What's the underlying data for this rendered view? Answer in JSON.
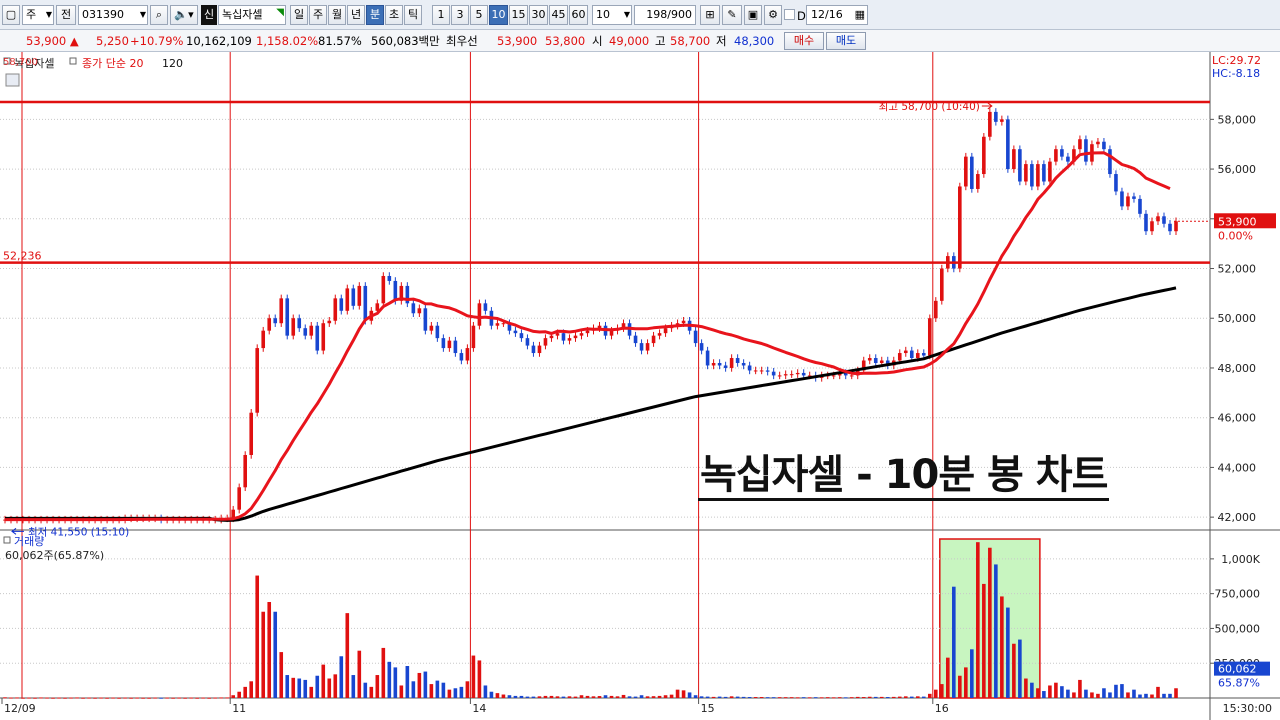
{
  "toolbar": {
    "type_label": "주",
    "all_label": "전",
    "code": "031390",
    "stock_badge": "신",
    "stock_name": "녹십자셀",
    "periods": [
      "일",
      "주",
      "월",
      "년",
      "분",
      "초",
      "틱"
    ],
    "active_period": "분",
    "intervals": [
      "1",
      "3",
      "5",
      "10",
      "15",
      "30",
      "45",
      "60"
    ],
    "active_interval": "10",
    "interval_value": "10",
    "count": "198",
    "count_total": "/900",
    "date_check": "D",
    "date": "12/16"
  },
  "quote": {
    "price": "53,900",
    "change": "5,250",
    "change_pct": "+10.79%",
    "volume": "10,162,109",
    "vol_ratio": "1,158.02%",
    "turnover": "81.57%",
    "amount": "560,083백만",
    "priority_label": "최우선",
    "ask": "53,900",
    "bid": "53,800",
    "open_label": "시",
    "open": "49,000",
    "high_label": "고",
    "high": "58,700",
    "low_label": "저",
    "low": "48,300",
    "buy_label": "매수",
    "sell_label": "매도"
  },
  "legend": {
    "series1": "녹십자셀",
    "ma_label": "종가 단순 20",
    "ma2": "120",
    "top_left_value": "58,700"
  },
  "annotations": {
    "high": "최고 58,700 (10:40)",
    "low": "최저 41,550 (15:10)",
    "hline_label": "52,236",
    "lc": "LC:29.72",
    "hc": "HC:-8.18",
    "current_price": "53,900",
    "current_pct": "0.00%",
    "overlay_title": "녹십자셀 - 10분 봉 차트",
    "volume_label": "거래량",
    "volume_value": "60,062주(65.87%)",
    "volume_current": "60,062",
    "volume_pct": "65.87%"
  },
  "colors": {
    "up": "#e01010",
    "down": "#1846d0",
    "ma20": "#e8141c",
    "ma120": "#000000",
    "highlight": "#c8f5c0"
  },
  "chart_data": {
    "type": "candlestick",
    "price_axis": {
      "min": 41000,
      "max": 59100,
      "ticks": [
        42000,
        44000,
        46000,
        48000,
        50000,
        52000,
        54000,
        56000,
        58000
      ]
    },
    "volume_axis": {
      "min": 0,
      "max": 1150000,
      "ticks": [
        250000,
        500000,
        750000,
        1000000
      ],
      "tick_labels": [
        "250,000",
        "500,000",
        "750,000",
        "1,000K"
      ]
    },
    "time_labels": [
      {
        "i": 0,
        "label": "12/09"
      },
      {
        "i": 38,
        "label": "11"
      },
      {
        "i": 78,
        "label": "14"
      },
      {
        "i": 116,
        "label": "15"
      },
      {
        "i": 155,
        "label": "16"
      }
    ],
    "time_end_label": "15:30:00",
    "hline": 52236,
    "high_line": 58700,
    "closes": [
      41900,
      41900,
      41900,
      41900,
      41900,
      41900,
      41900,
      41900,
      41900,
      41900,
      41900,
      41900,
      41900,
      41900,
      41900,
      41900,
      41900,
      41900,
      41900,
      41900,
      41950,
      41950,
      41950,
      41950,
      41950,
      41950,
      41900,
      41900,
      41900,
      41900,
      41900,
      41900,
      41900,
      41900,
      41900,
      41900,
      41950,
      41950,
      42300,
      43200,
      44500,
      46200,
      48800,
      49500,
      50000,
      49800,
      50800,
      49300,
      50000,
      49600,
      49300,
      49700,
      48700,
      49800,
      49900,
      50800,
      50300,
      51200,
      50500,
      51300,
      49900,
      50300,
      50600,
      51700,
      51500,
      50700,
      51300,
      50600,
      50200,
      50400,
      49500,
      49700,
      49200,
      48800,
      49100,
      48600,
      48300,
      48800,
      49700,
      50600,
      50300,
      49700,
      49800,
      49800,
      49500,
      49400,
      49200,
      48900,
      48600,
      48900,
      49200,
      49300,
      49400,
      49100,
      49200,
      49300,
      49400,
      49500,
      49600,
      49700,
      49300,
      49500,
      49600,
      49800,
      49300,
      49000,
      48700,
      49000,
      49300,
      49400,
      49600,
      49700,
      49800,
      49900,
      49500,
      49000,
      48700,
      48100,
      48200,
      48100,
      48000,
      48400,
      48200,
      48100,
      47900,
      47900,
      47900,
      47850,
      47700,
      47700,
      47750,
      47750,
      47800,
      47700,
      47700,
      47600,
      47700,
      47700,
      47700,
      47800,
      47700,
      47700,
      47900,
      48300,
      48400,
      48200,
      48300,
      48100,
      48300,
      48600,
      48700,
      48400,
      48600,
      48500,
      50000,
      50700,
      52000,
      52500,
      52000,
      55300,
      56500,
      55200,
      55800,
      57300,
      58300,
      57900,
      58000,
      56000,
      56800,
      55500,
      56200,
      55300,
      56200,
      55500,
      56300,
      56800,
      56500,
      56300,
      56800,
      57200,
      56300,
      57000,
      57100,
      56800,
      55800,
      55100,
      54500,
      54900,
      54800,
      54200,
      53500,
      53900,
      54100,
      53800,
      53500,
      53900
    ],
    "volumes": [
      5000,
      3000,
      4000,
      2000,
      3000,
      2000,
      4000,
      3000,
      2000,
      3000,
      2000,
      3000,
      4000,
      2000,
      3000,
      2000,
      3000,
      2000,
      3000,
      2000,
      3000,
      2000,
      3000,
      2000,
      2000,
      3000,
      2000,
      3000,
      2000,
      3000,
      2000,
      3000,
      2000,
      3000,
      2000,
      3000,
      4000,
      4000,
      20000,
      45000,
      80000,
      120000,
      880000,
      620000,
      690000,
      620000,
      330000,
      165000,
      145000,
      140000,
      130000,
      80000,
      160000,
      240000,
      140000,
      170000,
      300000,
      610000,
      165000,
      340000,
      110000,
      80000,
      165000,
      360000,
      260000,
      220000,
      90000,
      230000,
      120000,
      180000,
      190000,
      100000,
      125000,
      110000,
      60000,
      70000,
      80000,
      120000,
      305000,
      270000,
      90000,
      45000,
      35000,
      25000,
      20000,
      15000,
      15000,
      10000,
      10000,
      12000,
      15000,
      15000,
      12000,
      10000,
      12000,
      10000,
      20000,
      15000,
      12000,
      14000,
      20000,
      15000,
      12000,
      22000,
      12000,
      10000,
      20000,
      12000,
      13000,
      15000,
      20000,
      24000,
      60000,
      55000,
      40000,
      20000,
      12000,
      10000,
      8000,
      10000,
      8000,
      12000,
      10000,
      8000,
      7000,
      7000,
      7000,
      6000,
      6000,
      6000,
      6000,
      6000,
      5000,
      6000,
      5000,
      6000,
      5000,
      6000,
      5000,
      6000,
      5000,
      6000,
      8000,
      7000,
      9000,
      8000,
      8000,
      7000,
      8000,
      10000,
      12000,
      10000,
      12000,
      10000,
      30000,
      60000,
      100000,
      290000,
      800000,
      160000,
      220000,
      350000,
      1120000,
      820000,
      1080000,
      960000,
      730000,
      650000,
      390000,
      420000,
      140000,
      110000,
      70000,
      50000,
      90000,
      110000,
      85000,
      60000,
      40000,
      130000,
      60000,
      40000,
      30000,
      70000,
      40000,
      95000,
      100000,
      40000,
      60000,
      25000,
      30000,
      25000,
      80000,
      30000,
      30000,
      70000,
      55000,
      60062
    ],
    "ma20": [
      41900,
      41900,
      41900,
      41900,
      41900,
      41900,
      41900,
      41900,
      41900,
      41900,
      41900,
      41900,
      41900,
      41900,
      41900,
      41900,
      41900,
      41900,
      41900,
      41900,
      41903,
      41905,
      41908,
      41910,
      41913,
      41915,
      41915,
      41915,
      41915,
      41915,
      41915,
      41915,
      41915,
      41915,
      41915,
      41915,
      41918,
      41920,
      41938,
      42003,
      42133,
      42348,
      42693,
      43073,
      43478,
      43870,
      44310,
      44678,
      45083,
      45468,
      45833,
      46220,
      46560,
      46953,
      47350,
      47795,
      48213,
      48678,
      49108,
      49568,
      49935,
      50090,
      50195,
      50470,
      50600,
      50740,
      50785,
      50753,
      50770,
      50700,
      50580,
      50575,
      50500,
      50455,
      50415,
      50330,
      50220,
      50100,
      50060,
      50025,
      50045,
      50015,
      49990,
      49895,
      49795,
      49725,
      49620,
      49550,
      49470,
      49445,
      49455,
      49385,
      49475,
      49470,
      49445,
      49480,
      49535,
      49570,
      49560,
      49555,
      49545,
      49535,
      49555,
      49605,
      49595,
      49575,
      49575,
      49580,
      49615,
      49640,
      49660,
      49680,
      49700,
      49715,
      49715,
      49700,
      49665,
      49595,
      49525,
      49445,
      49380,
      49325,
      49255,
      49170,
      49100,
      49045,
      48985,
      48900,
      48805,
      48715,
      48625,
      48545,
      48460,
      48370,
      48290,
      48220,
      48170,
      48105,
      48040,
      47935,
      47855,
      47790,
      47775,
      47785,
      47795,
      47790,
      47800,
      47813,
      47838,
      47883,
      47930,
      47963,
      48003,
      48040,
      48155,
      48303,
      48520,
      48758,
      48973,
      49353,
      49793,
      50168,
      50573,
      51053,
      51558,
      52018,
      52503,
      52873,
      53303,
      53658,
      54055,
      54390,
      54790,
      55040,
      55325,
      55635,
      55873,
      56093,
      56338,
      56578,
      56620,
      56645,
      56650,
      56653,
      56528,
      56358,
      56185,
      56113,
      56023,
      55858,
      55638,
      55530,
      55420,
      55320,
      55213
    ],
    "ma120": [
      41950,
      41950,
      41950,
      41950,
      41950,
      41950,
      41950,
      41950,
      41950,
      41950,
      41950,
      41950,
      41950,
      41950,
      41950,
      41950,
      41950,
      41950,
      41950,
      41950,
      41950,
      41950,
      41950,
      41950,
      41950,
      41950,
      41950,
      41950,
      41950,
      41950,
      41950,
      41950,
      41950,
      41950,
      41950,
      41900,
      41880,
      41870,
      41875,
      41900,
      41960,
      42040,
      42140,
      42230,
      42310,
      42380,
      42450,
      42520,
      42590,
      42660,
      42730,
      42800,
      42870,
      42940,
      43010,
      43080,
      43150,
      43220,
      43290,
      43360,
      43430,
      43500,
      43570,
      43640,
      43710,
      43780,
      43850,
      43920,
      43990,
      44060,
      44130,
      44200,
      44270,
      44330,
      44390,
      44450,
      44510,
      44570,
      44630,
      44690,
      44750,
      44810,
      44870,
      44930,
      44990,
      45050,
      45110,
      45170,
      45230,
      45290,
      45350,
      45410,
      45470,
      45530,
      45590,
      45650,
      45710,
      45770,
      45830,
      45890,
      45950,
      46010,
      46070,
      46130,
      46190,
      46250,
      46310,
      46370,
      46430,
      46490,
      46550,
      46610,
      46670,
      46730,
      46790,
      46850,
      46890,
      46930,
      46970,
      47010,
      47050,
      47090,
      47130,
      47170,
      47210,
      47250,
      47290,
      47330,
      47370,
      47410,
      47450,
      47490,
      47530,
      47570,
      47610,
      47650,
      47690,
      47730,
      47770,
      47810,
      47850,
      47890,
      47930,
      47970,
      48010,
      48050,
      48090,
      48130,
      48170,
      48210,
      48250,
      48290,
      48330,
      48370,
      48450,
      48530,
      48610,
      48690,
      48770,
      48850,
      48930,
      49010,
      49090,
      49170,
      49250,
      49330,
      49410,
      49480,
      49550,
      49620,
      49690,
      49760,
      49830,
      49900,
      49970,
      50040,
      50110,
      50180,
      50250,
      50320,
      50380,
      50440,
      50500,
      50560,
      50620,
      50680,
      50740,
      50800,
      50860,
      50920,
      50970,
      51020,
      51070,
      51120,
      51170,
      51220
    ]
  }
}
